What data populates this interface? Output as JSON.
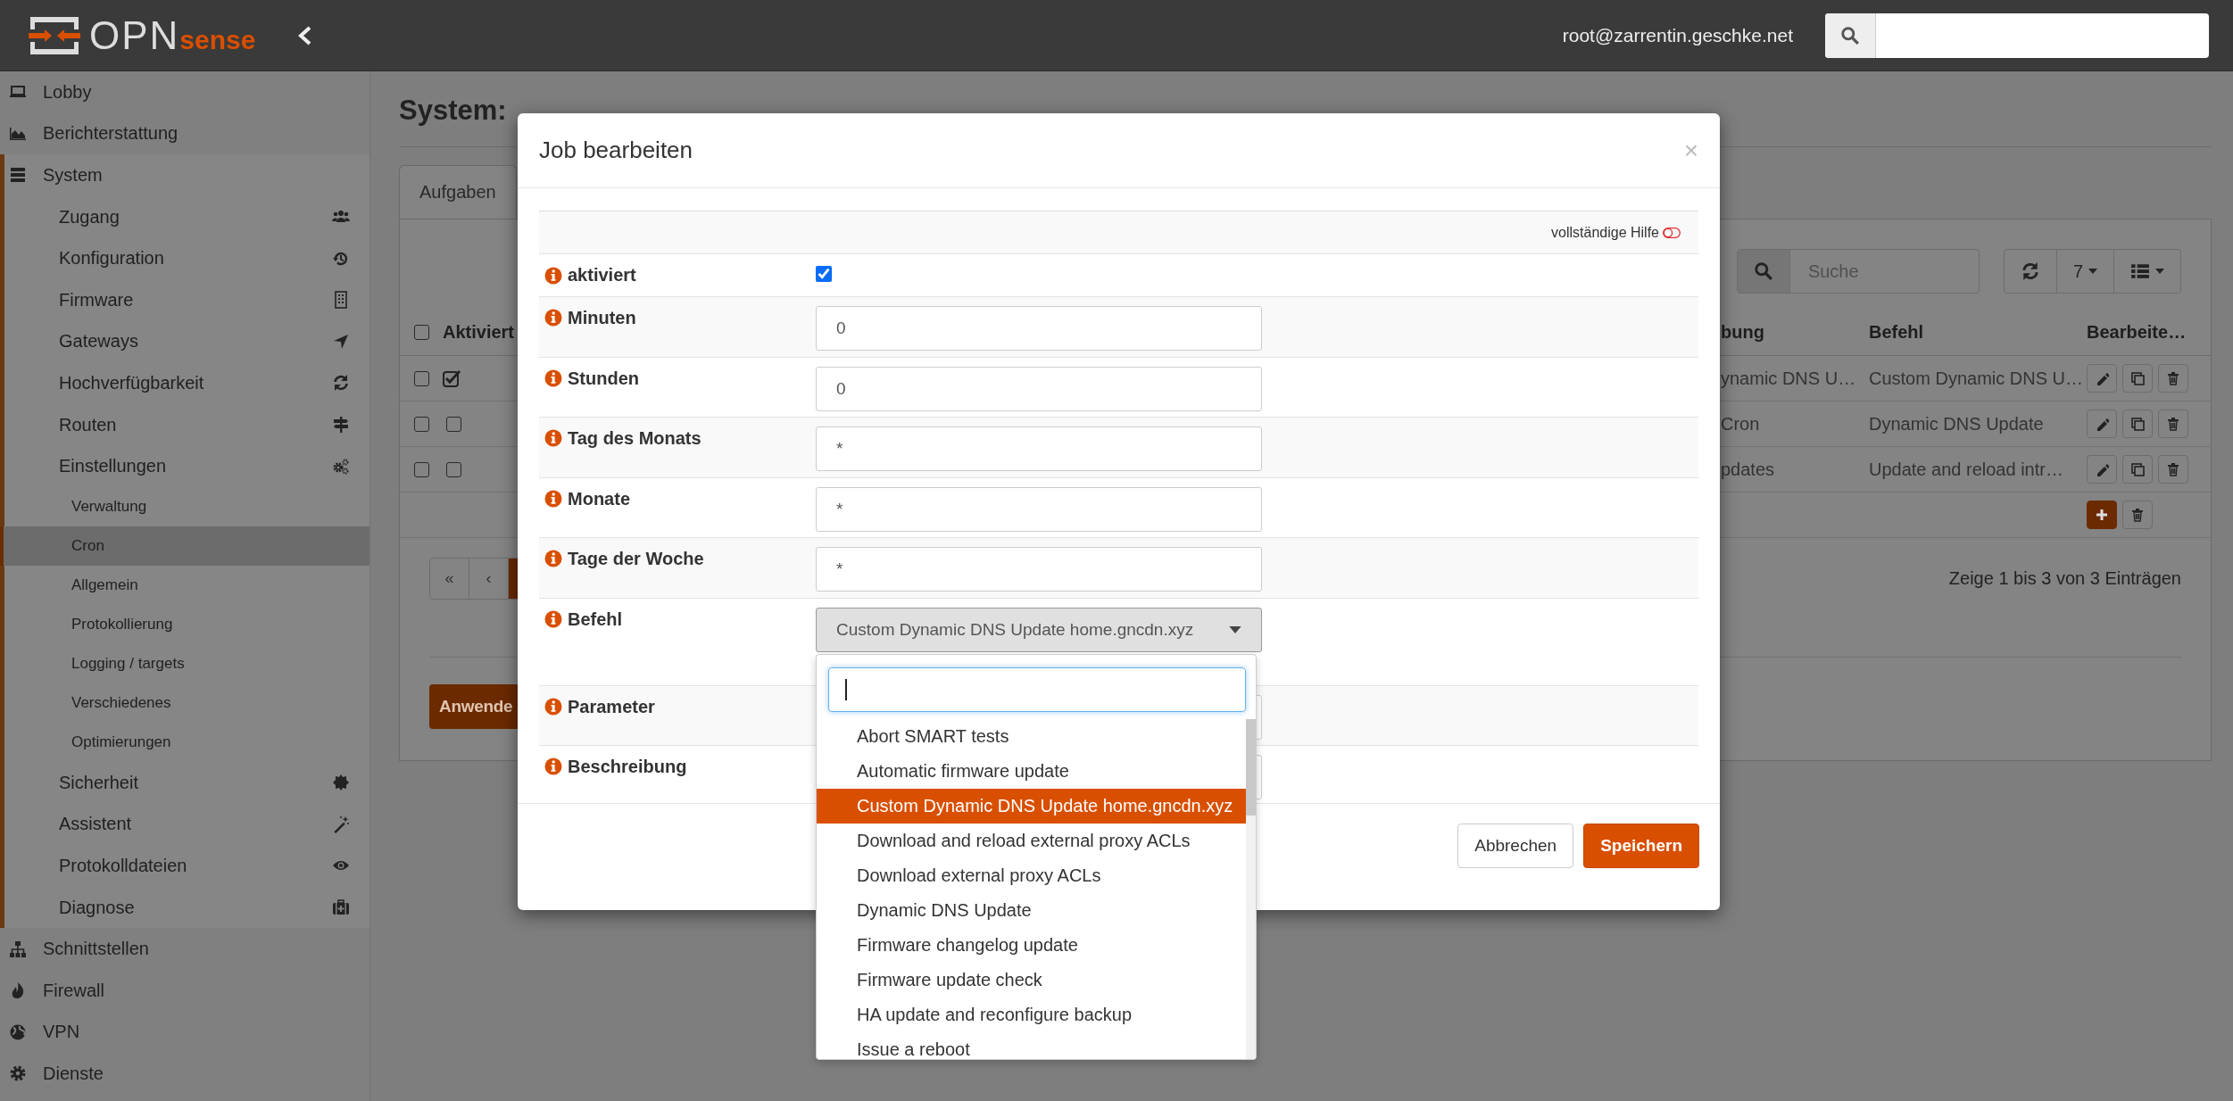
{
  "header": {
    "logo": {
      "text": "OPN",
      "accent": "sense"
    },
    "user": "root@zarrentin.geschke.net"
  },
  "sidebar": {
    "items": [
      {
        "label": "Lobby",
        "selected": false,
        "expanded": false
      },
      {
        "label": "Berichterstattung",
        "selected": false,
        "expanded": false
      },
      {
        "label": "System",
        "selected": false,
        "expanded": true,
        "children": [
          {
            "label": "Zugang",
            "selected": false
          },
          {
            "label": "Konfiguration",
            "selected": false
          },
          {
            "label": "Firmware",
            "selected": false
          },
          {
            "label": "Gateways",
            "selected": false
          },
          {
            "label": "Hochverfügbarkeit",
            "selected": false
          },
          {
            "label": "Routen",
            "selected": false
          },
          {
            "label": "Einstellungen",
            "selected": false,
            "children": [
              {
                "label": "Verwaltung",
                "selected": false
              },
              {
                "label": "Cron",
                "selected": true
              },
              {
                "label": "Allgemein",
                "selected": false
              },
              {
                "label": "Protokollierung",
                "selected": false
              },
              {
                "label": "Logging / targets",
                "selected": false
              },
              {
                "label": "Verschiedenes",
                "selected": false
              },
              {
                "label": "Optimierungen",
                "selected": false
              }
            ]
          },
          {
            "label": "Sicherheit",
            "selected": false
          },
          {
            "label": "Assistent",
            "selected": false
          },
          {
            "label": "Protokolldateien",
            "selected": false
          },
          {
            "label": "Diagnose",
            "selected": false
          }
        ]
      },
      {
        "label": "Schnittstellen",
        "selected": false,
        "expanded": false
      },
      {
        "label": "Firewall",
        "selected": false,
        "expanded": false
      },
      {
        "label": "VPN",
        "selected": false,
        "expanded": false
      },
      {
        "label": "Dienste",
        "selected": false,
        "expanded": false
      }
    ]
  },
  "page": {
    "title": "System:",
    "tabs": [
      {
        "label": "Aufgaben",
        "selected": true
      }
    ],
    "toolbar": {
      "search_placeholder": "Suche",
      "page_size": "7"
    },
    "table": {
      "all_selected": false,
      "columns": [
        "Aktiviert",
        "bung",
        "Befehl",
        "Bearbeite…"
      ],
      "rows": [
        {
          "selected": false,
          "enabled": true,
          "column_3": "ynamic DNS U…",
          "command": "Custom Dynamic DNS U…"
        },
        {
          "selected": false,
          "enabled": false,
          "column_3": "Cron",
          "command": "Dynamic DNS Update"
        },
        {
          "selected": false,
          "enabled": false,
          "column_3": "pdates",
          "command": "Update and reload intr…"
        }
      ]
    },
    "pagination": [
      "«",
      "‹"
    ],
    "summary": "Zeige 1 bis 3 von 3 Einträgen",
    "apply_button": "Anwende"
  },
  "modal": {
    "title": "Job bearbeiten",
    "close": "×",
    "help": {
      "label": "vollständige Hilfe",
      "on": false
    },
    "fields": [
      {
        "kind": "checkbox",
        "label": "aktiviert",
        "checked": true
      },
      {
        "kind": "text",
        "label": "Minuten",
        "value": "0"
      },
      {
        "kind": "text",
        "label": "Stunden",
        "value": "0"
      },
      {
        "kind": "text",
        "label": "Tag des Monats",
        "value": "*"
      },
      {
        "kind": "text",
        "label": "Monate",
        "value": "*"
      },
      {
        "kind": "text",
        "label": "Tage der Woche",
        "value": "*"
      },
      {
        "kind": "select",
        "label": "Befehl",
        "value": "Custom Dynamic DNS Update home.gncdn.xyz",
        "open": true
      },
      {
        "kind": "text",
        "label": "Parameter"
      },
      {
        "kind": "text",
        "label": "Beschreibung"
      }
    ],
    "dropdown": {
      "options": [
        {
          "label": "Abort SMART tests",
          "selected": false
        },
        {
          "label": "Automatic firmware update",
          "selected": false
        },
        {
          "label": "Custom Dynamic DNS Update home.gncdn.xyz",
          "selected": true
        },
        {
          "label": "Download and reload external proxy ACLs",
          "selected": false
        },
        {
          "label": "Download external proxy ACLs",
          "selected": false
        },
        {
          "label": "Dynamic DNS Update",
          "selected": false
        },
        {
          "label": "Firmware changelog update",
          "selected": false
        },
        {
          "label": "Firmware update check",
          "selected": false
        },
        {
          "label": "HA update and reconfigure backup",
          "selected": false
        },
        {
          "label": "Issue a reboot",
          "selected": false
        }
      ]
    },
    "buttons": [
      {
        "kind": "secondary",
        "label": "Abbrechen"
      },
      {
        "kind": "primary",
        "label": "Speichern"
      }
    ]
  }
}
